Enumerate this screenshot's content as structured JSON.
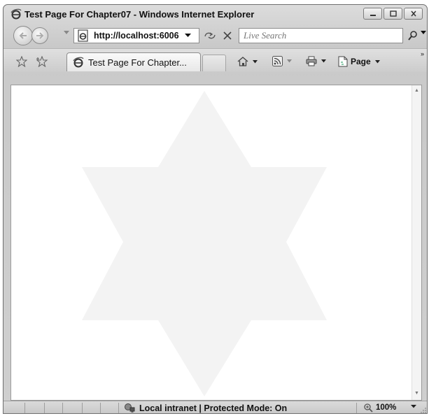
{
  "window": {
    "title": "Test Page For Chapter07 - Windows Internet Explorer"
  },
  "address_bar": {
    "url": "http://localhost:6006"
  },
  "search": {
    "placeholder": "Live Search"
  },
  "tabs": [
    {
      "label": "Test Page For Chapter..."
    }
  ],
  "command_bar": {
    "page_label": "Page"
  },
  "status_bar": {
    "zone": "Local intranet | Protected Mode: On",
    "zoom": "100%"
  },
  "icons": {
    "ie": "ie-logo-icon",
    "back": "back-arrow-icon",
    "forward": "forward-arrow-icon",
    "refresh": "refresh-icon",
    "stop": "stop-x-icon",
    "search": "magnifier-icon",
    "favorites": "star-icon",
    "add_favorites": "add-favorite-icon",
    "home": "home-icon",
    "feeds": "rss-icon",
    "print": "printer-icon",
    "page": "page-icon",
    "zone": "network-icon",
    "zoom": "zoom-icon"
  },
  "colors": {
    "star_fill": "#f3f3f3",
    "chrome": "#d0d0d0"
  }
}
